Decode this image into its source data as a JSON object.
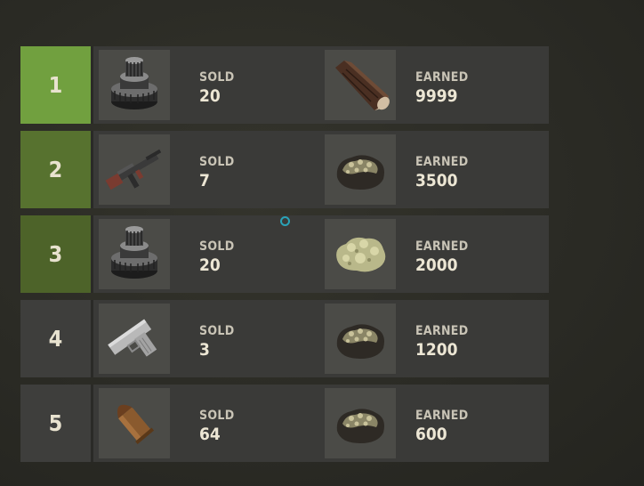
{
  "leaderboard": {
    "rows": [
      {
        "rank": "1",
        "item_icon": "gears-icon",
        "sold_label": "SOLD",
        "sold": "20",
        "reward_icon": "wood-log-icon",
        "earned_label": "EARNED",
        "earned": "9999"
      },
      {
        "rank": "2",
        "item_icon": "assault-rifle-icon",
        "sold_label": "SOLD",
        "sold": "7",
        "reward_icon": "metal-ore-icon",
        "earned_label": "EARNED",
        "earned": "3500"
      },
      {
        "rank": "3",
        "item_icon": "gears-icon",
        "sold_label": "SOLD",
        "sold": "20",
        "reward_icon": "sulfur-ore-icon",
        "earned_label": "EARNED",
        "earned": "2000"
      },
      {
        "rank": "4",
        "item_icon": "pistol-icon",
        "sold_label": "SOLD",
        "sold": "3",
        "reward_icon": "metal-ore-icon",
        "earned_label": "EARNED",
        "earned": "1200"
      },
      {
        "rank": "5",
        "item_icon": "bullet-icon",
        "sold_label": "SOLD",
        "sold": "64",
        "reward_icon": "metal-ore-icon",
        "earned_label": "EARNED",
        "earned": "600"
      }
    ]
  },
  "colors": {
    "rank1": "#71a03f",
    "rank2": "#57722f",
    "rank3": "#4d6329",
    "rank_default": "#3e3e3c",
    "panel": "#3a3a38",
    "slot": "#4b4b47",
    "cursor": "#2aa3b8"
  }
}
